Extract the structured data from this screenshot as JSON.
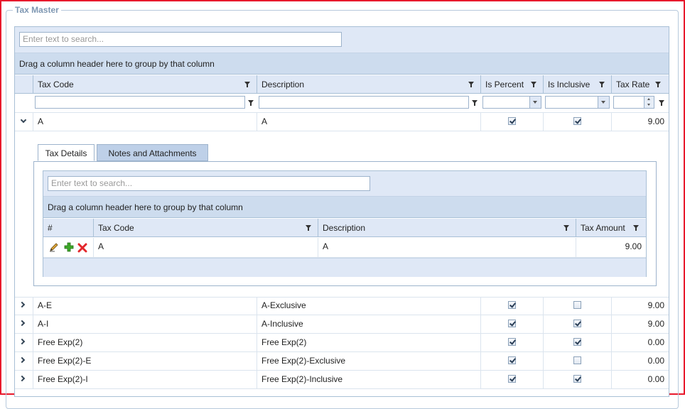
{
  "panel": {
    "title": "Tax Master"
  },
  "grid": {
    "search_placeholder": "Enter text to search...",
    "group_hint": "Drag a column header here to group by that column",
    "columns": [
      "Tax Code",
      "Description",
      "Is Percent",
      "Is Inclusive",
      "Tax Rate"
    ],
    "rows": [
      {
        "code": "A",
        "description": "A",
        "is_percent": true,
        "is_inclusive": true,
        "rate": "9.00",
        "expanded": true
      },
      {
        "code": "A-E",
        "description": "A-Exclusive",
        "is_percent": true,
        "is_inclusive": false,
        "rate": "9.00",
        "expanded": false
      },
      {
        "code": "A-I",
        "description": "A-Inclusive",
        "is_percent": true,
        "is_inclusive": true,
        "rate": "9.00",
        "expanded": false
      },
      {
        "code": "Free Exp(2)",
        "description": "Free Exp(2)",
        "is_percent": true,
        "is_inclusive": true,
        "rate": "0.00",
        "expanded": false
      },
      {
        "code": "Free Exp(2)-E",
        "description": "Free Exp(2)-Exclusive",
        "is_percent": true,
        "is_inclusive": false,
        "rate": "0.00",
        "expanded": false
      },
      {
        "code": "Free Exp(2)-I",
        "description": "Free Exp(2)-Inclusive",
        "is_percent": true,
        "is_inclusive": true,
        "rate": "0.00",
        "expanded": false
      }
    ]
  },
  "detail": {
    "tabs": [
      "Tax Details",
      "Notes and Attachments"
    ],
    "active_tab": "Tax Details",
    "sub_grid": {
      "search_placeholder": "Enter text to search...",
      "group_hint": "Drag a column header here to group by that column",
      "columns": [
        "#",
        "Tax Code",
        "Description",
        "Tax Amount"
      ],
      "rows": [
        {
          "code": "A",
          "description": "A",
          "amount": "9.00"
        }
      ]
    }
  },
  "colors": {
    "frame": "#e8192c",
    "header_bg": "#dfe8f6",
    "group_bg": "#cddcee",
    "tab_inactive": "#bed0e8"
  },
  "icons": [
    "edit-icon",
    "add-icon",
    "delete-icon",
    "filter-icon",
    "chevron-down-icon",
    "chevron-right-icon"
  ]
}
